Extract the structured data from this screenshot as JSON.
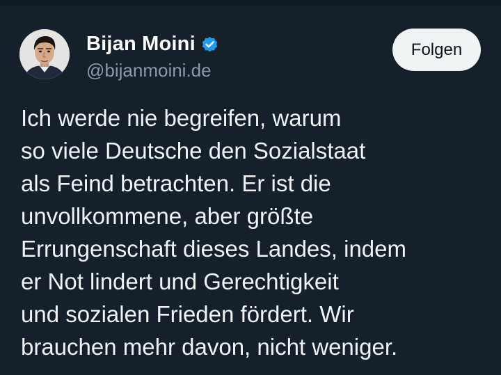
{
  "author": {
    "display_name": "Bijan Moini",
    "handle": "@bijanmoini.de",
    "verified": true,
    "avatar_icon": "profile-photo"
  },
  "actions": {
    "follow_label": "Folgen"
  },
  "tweet": {
    "lines": [
      "Ich werde nie begreifen, warum",
      "so viele Deutsche den Sozialstaat",
      "als Feind betrachten. Er ist die",
      "unvollkommene, aber größte",
      "Errungenschaft dieses Landes, indem",
      "er Not lindert und Gerechtigkeit",
      "und sozialen Frieden fördert. Wir",
      "brauchen mehr davon, nicht weniger."
    ]
  },
  "colors": {
    "background": "#15202b",
    "verified_badge": "#1d9bf0",
    "handle": "#8b98a5",
    "follow_button_bg": "#eff3f4"
  }
}
